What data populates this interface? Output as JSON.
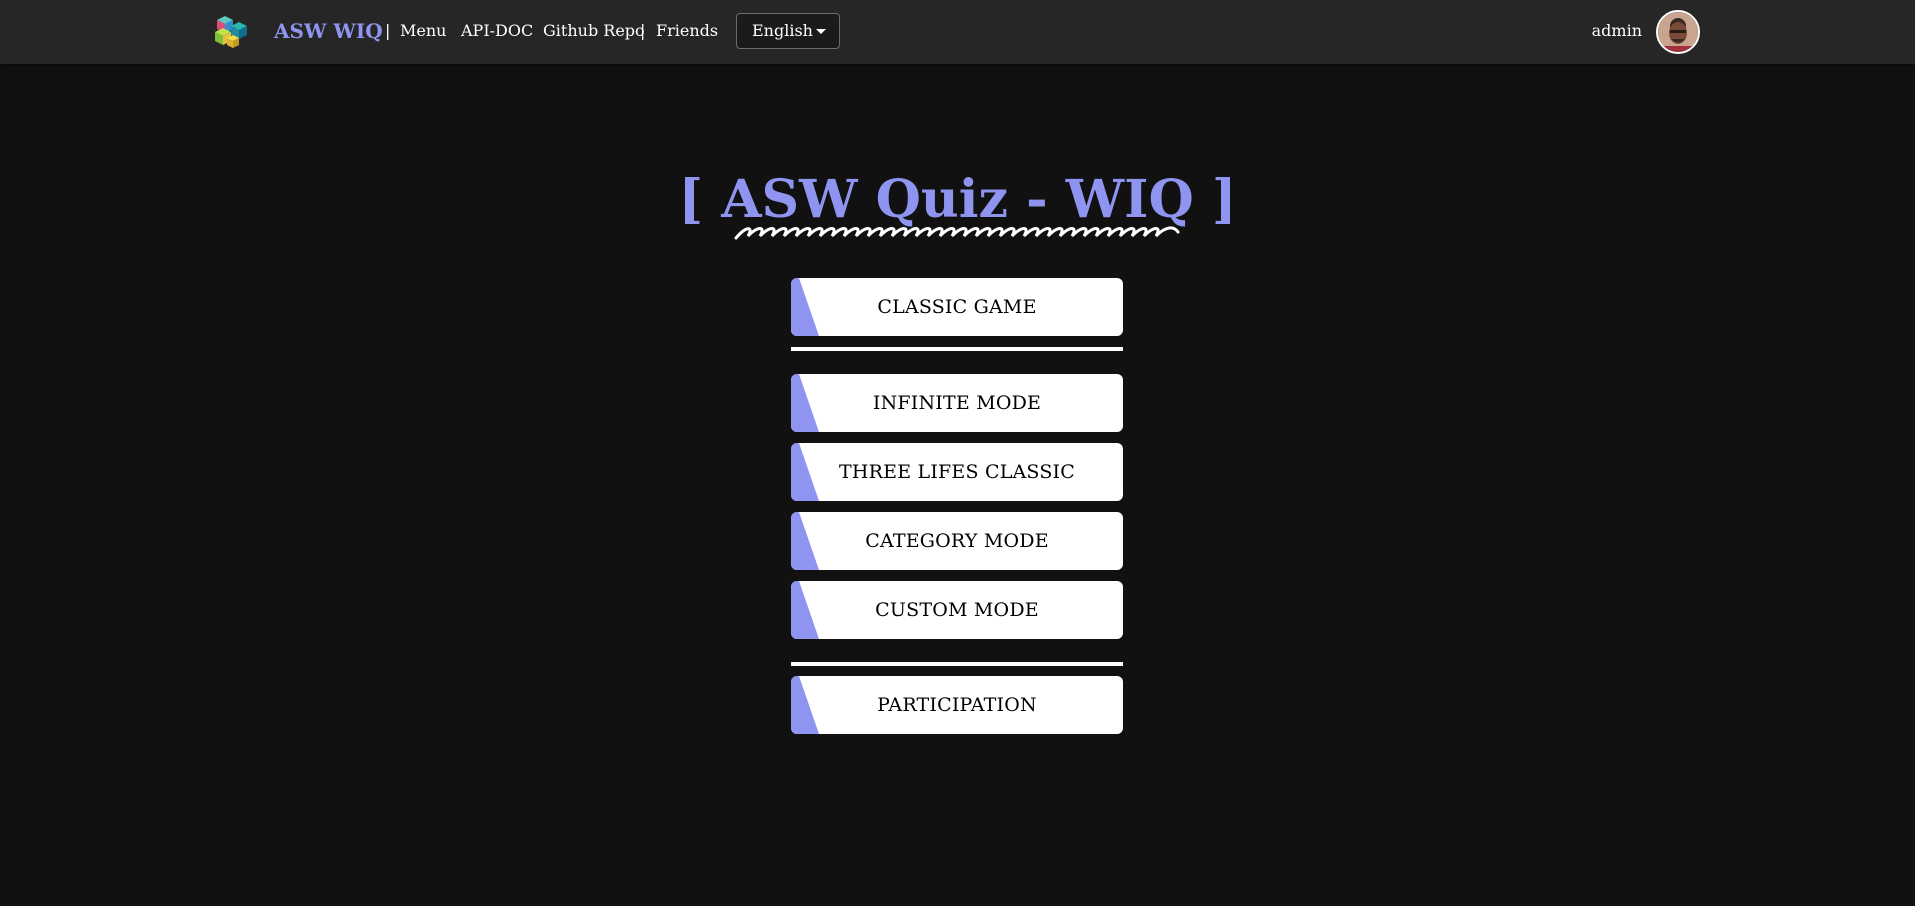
{
  "colors": {
    "accent": "#8f94f0",
    "navbar_bg": "#262626",
    "page_bg": "#111111",
    "button_bg": "#ffffff"
  },
  "navbar": {
    "brand": "ASW WIQ",
    "separator": "|",
    "links": {
      "menu": "Menu",
      "api_doc": "API-DOC",
      "github": "Github Repo",
      "friends": "Friends"
    },
    "language": {
      "selected": "English"
    },
    "user": {
      "name": "admin"
    }
  },
  "main": {
    "title": "[ ASW Quiz - WIQ ]",
    "buttons": {
      "classic": "CLASSIC GAME",
      "infinite": "INFINITE MODE",
      "three_lifes": "THREE LIFES CLASSIC",
      "category": "CATEGORY MODE",
      "custom": "CUSTOM MODE",
      "participation": "PARTICIPATION"
    }
  }
}
